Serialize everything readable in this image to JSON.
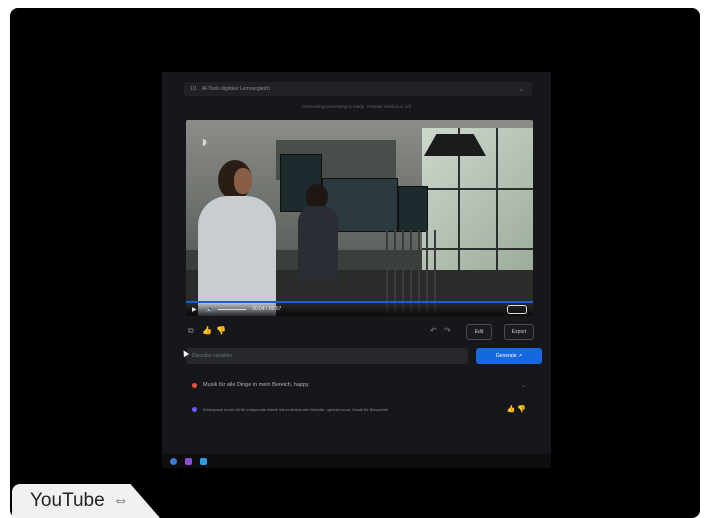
{
  "app": {
    "topbar": {
      "num": "1/1",
      "title": "Al-Tools digitaler Lernvergleich",
      "dropdown_icon": "chevron-down-icon"
    },
    "status": "Generating processing is ready. Youtube session is 1/3",
    "video": {
      "time": "00:04 / 00:07",
      "progress": 1.0
    },
    "actions": {
      "edit_label": "Edit",
      "export_label": "Export"
    },
    "prompt": {
      "placeholder": "Describe variation",
      "generate_label": "Generate ↗"
    },
    "history": [
      {
        "text": "Musik für alle Dinge in mein Bereich, happy",
        "color": "#e8503a"
      },
      {
        "text": "Workspace music kit für entspannte Arbeit mit motivierender Melodie, upbeat mood, Musik für Büroarbeit",
        "color": "#6a5af9"
      }
    ]
  },
  "youtube_tab": {
    "label": "YouTube",
    "icon": "link-icon"
  }
}
